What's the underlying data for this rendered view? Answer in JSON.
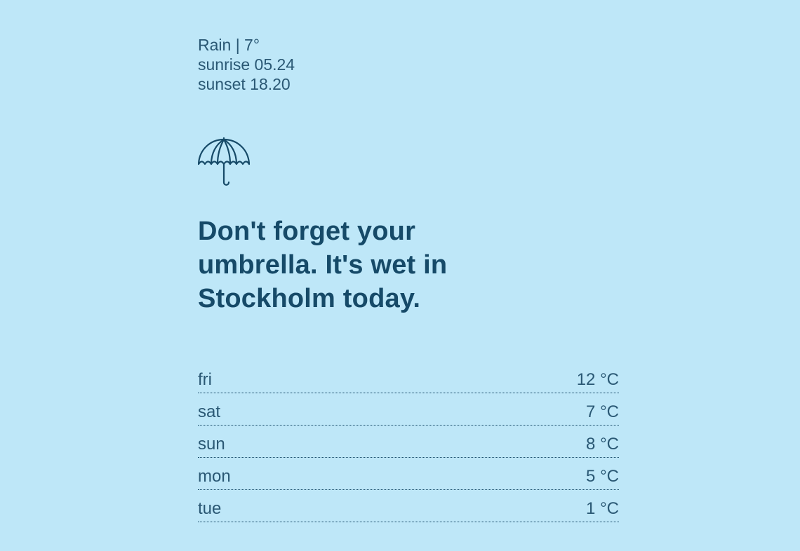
{
  "weather": {
    "summary": "Rain | 7°",
    "sunrise": "sunrise 05.24",
    "sunset": "sunset 18.20",
    "icon": "umbrella-icon",
    "headline": "Don't forget your umbrella. It's wet in Stockholm today."
  },
  "forecast": [
    {
      "day": "fri",
      "temp": "12 °C"
    },
    {
      "day": "sat",
      "temp": "7 °C"
    },
    {
      "day": "sun",
      "temp": "8 °C"
    },
    {
      "day": "mon",
      "temp": "5 °C"
    },
    {
      "day": "tue",
      "temp": "1 °C"
    }
  ],
  "colors": {
    "background": "#bee7f8",
    "text": "#164a68"
  }
}
